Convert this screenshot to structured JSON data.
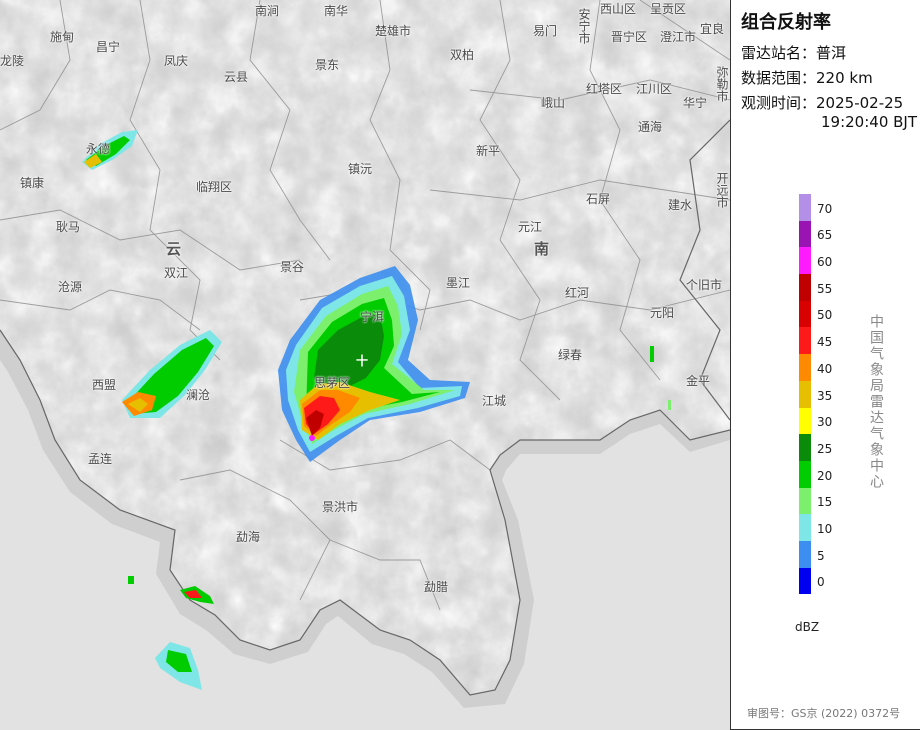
{
  "panel": {
    "title": "组合反射率",
    "station_label": "雷达站名：",
    "station": "普洱",
    "range_label": "数据范围：",
    "range": "220 km",
    "time_label": "观测时间：",
    "time_date": "2025-02-25",
    "time_clock": "19:20:40 BJT",
    "org": "中国气象局雷达气象中心",
    "unit": "dBZ",
    "review": "审图号：GS京 (2022) 0372号"
  },
  "legend": [
    {
      "value": "70",
      "color": "#b38fe8"
    },
    {
      "value": "65",
      "color": "#9a14b4"
    },
    {
      "value": "60",
      "color": "#ff1aff"
    },
    {
      "value": "55",
      "color": "#c00000"
    },
    {
      "value": "50",
      "color": "#d80000"
    },
    {
      "value": "45",
      "color": "#ff1a1a"
    },
    {
      "value": "40",
      "color": "#ff8a00"
    },
    {
      "value": "35",
      "color": "#e6c000"
    },
    {
      "value": "30",
      "color": "#ffff00"
    },
    {
      "value": "25",
      "color": "#0a8c0a"
    },
    {
      "value": "20",
      "color": "#00cc00"
    },
    {
      "value": "15",
      "color": "#7cf06c"
    },
    {
      "value": "10",
      "color": "#7ee6e6"
    },
    {
      "value": "5",
      "color": "#3c8ef0"
    },
    {
      "value": "0",
      "color": "#0000f0"
    }
  ],
  "places": [
    "南涧",
    "南华",
    "楚雄市",
    "易门",
    "安宁市",
    "西山区",
    "呈贡区",
    "宜良",
    "施甸",
    "昌宁",
    "凤庆",
    "双柏",
    "晋宁区",
    "澄江市",
    "龙陵",
    "云县",
    "景东",
    "峨山",
    "红塔区",
    "江川区",
    "华宁",
    "弥勒市",
    "镇康",
    "临翔区",
    "镇沅",
    "新平",
    "通海",
    "永德",
    "耿马",
    "元江",
    "石屏",
    "建水",
    "开远市",
    "沧源",
    "双江",
    "景谷",
    "墨江",
    "红河",
    "个旧市",
    "宁洱",
    "元阳",
    "西盟",
    "澜沧",
    "思茅区",
    "绿春",
    "金平",
    "孟连",
    "江城",
    "景洪市",
    "勐海",
    "勐腊",
    "云",
    "南"
  ]
}
